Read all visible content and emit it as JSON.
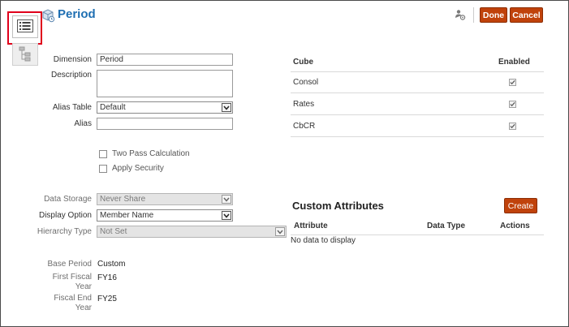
{
  "header": {
    "title": "Period",
    "done_label": "Done",
    "cancel_label": "Cancel"
  },
  "form": {
    "dimension_label": "Dimension",
    "dimension_value": "Period",
    "description_label": "Description",
    "alias_table_label": "Alias Table",
    "alias_table_value": "Default",
    "alias_label": "Alias",
    "two_pass_label": "Two Pass Calculation",
    "apply_security_label": "Apply Security",
    "data_storage_label": "Data Storage",
    "data_storage_value": "Never Share",
    "display_option_label": "Display Option",
    "display_option_value": "Member Name",
    "hierarchy_type_label": "Hierarchy Type",
    "hierarchy_type_value": "Not Set",
    "base_period_label": "Base Period",
    "base_period_value": "Custom",
    "first_fiscal_year_label_1": "First Fiscal",
    "first_fiscal_year_label_2": "Year",
    "first_fiscal_year_value": "FY16",
    "fiscal_end_year_label_1": "Fiscal End",
    "fiscal_end_year_label_2": "Year",
    "fiscal_end_year_value": "FY25"
  },
  "cubes": {
    "col_cube": "Cube",
    "col_enabled": "Enabled",
    "rows": [
      {
        "name": "Consol",
        "enabled": true
      },
      {
        "name": "Rates",
        "enabled": true
      },
      {
        "name": "CbCR",
        "enabled": true
      }
    ]
  },
  "custom_attributes": {
    "title": "Custom Attributes",
    "create_label": "Create",
    "col_attribute": "Attribute",
    "col_data_type": "Data Type",
    "col_actions": "Actions",
    "empty_text": "No data to display"
  },
  "colors": {
    "accent": "#c0420b",
    "title_blue": "#1f6fb2",
    "highlight": "#e0001b"
  }
}
